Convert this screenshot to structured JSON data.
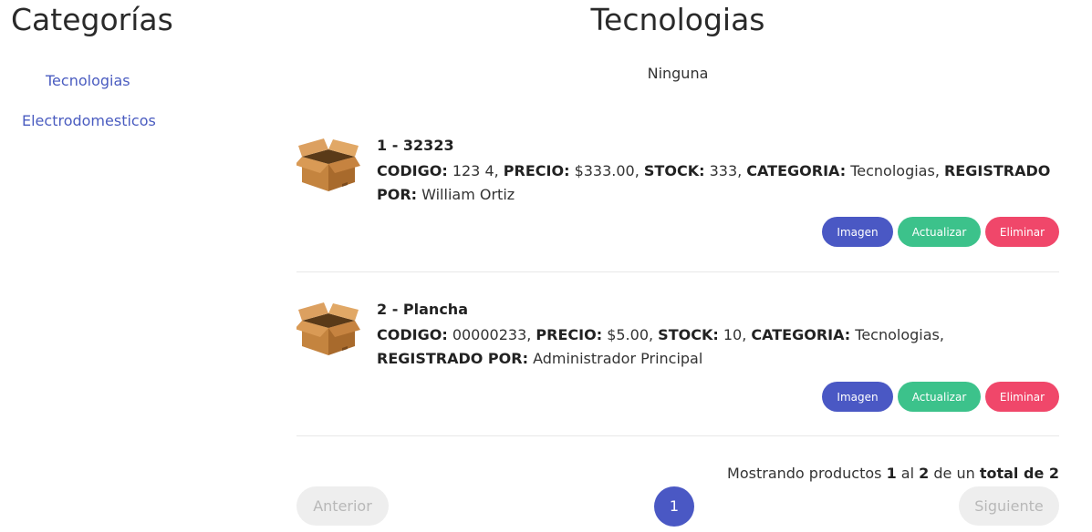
{
  "sidebar": {
    "title": "Categorías",
    "items": [
      {
        "label": "Tecnologias"
      },
      {
        "label": "Electrodomesticos"
      }
    ]
  },
  "main": {
    "title": "Tecnologias",
    "subtitle": "Ninguna"
  },
  "labels": {
    "codigo": "CODIGO:",
    "precio": "PRECIO:",
    "stock": "STOCK:",
    "categoria": "CATEGORIA:",
    "registrado": "REGISTRADO POR:"
  },
  "products": [
    {
      "title": "1 - 32323",
      "codigo": "123 4",
      "precio": "$333.00",
      "stock": "333",
      "categoria": "Tecnologias",
      "registrado": "William Ortiz",
      "image_icon": "box-icon"
    },
    {
      "title": "2 - Plancha",
      "codigo": "00000233",
      "precio": "$5.00",
      "stock": "10",
      "categoria": "Tecnologias",
      "registrado": "Administrador Principal",
      "image_icon": "box-icon"
    }
  ],
  "buttons": {
    "imagen": "Imagen",
    "actualizar": "Actualizar",
    "eliminar": "Eliminar"
  },
  "summary": {
    "prefix": "Mostrando productos",
    "from": "1",
    "mid": "al",
    "to": "2",
    "de_un": "de un",
    "total_label": "total de 2"
  },
  "pagination": {
    "prev": "Anterior",
    "current_page": "1",
    "next": "Siguiente"
  },
  "colors": {
    "primary": "#4a58c4",
    "success": "#3cc28b",
    "danger": "#f0476a",
    "link": "#4a5cc0"
  }
}
